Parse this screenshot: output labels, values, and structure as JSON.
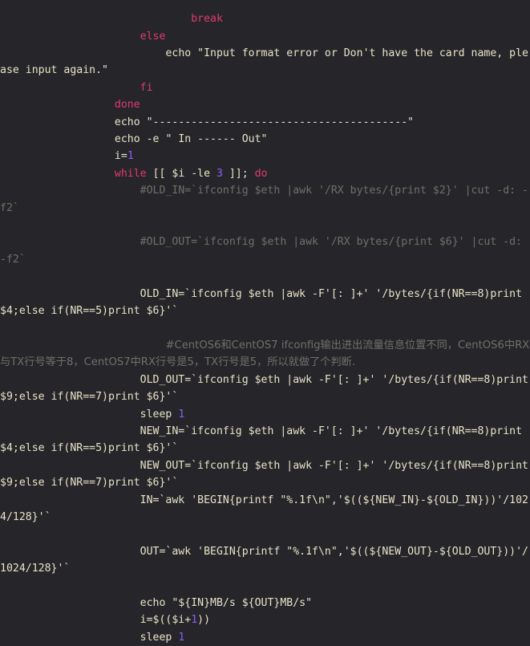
{
  "editor": {
    "background_color": "#26262a",
    "default_text_color": "#e8e2c8",
    "keyword_color": "#e03a6d",
    "number_color": "#8b5cf6",
    "comment_color": "#6f6f68",
    "language": "bash"
  },
  "code": {
    "lines": [
      {
        "indent": 30,
        "segments": [
          {
            "t": "break",
            "c": "kw"
          }
        ]
      },
      {
        "indent": 22,
        "segments": [
          {
            "t": "else",
            "c": "kw"
          }
        ]
      },
      {
        "indent": 26,
        "segments": [
          {
            "t": "echo \"Input format error or Don't have the card name, please input again.\"",
            "c": "plain"
          }
        ]
      },
      {
        "indent": 22,
        "segments": [
          {
            "t": "fi",
            "c": "kw"
          }
        ]
      },
      {
        "indent": 18,
        "segments": [
          {
            "t": "done",
            "c": "kw"
          }
        ]
      },
      {
        "indent": 18,
        "segments": [
          {
            "t": "echo \"----------------------------------------\"",
            "c": "plain"
          }
        ]
      },
      {
        "indent": 18,
        "segments": [
          {
            "t": "echo -e \" In ------ Out\"",
            "c": "plain"
          }
        ]
      },
      {
        "indent": 18,
        "segments": [
          {
            "t": "i=",
            "c": "plain"
          },
          {
            "t": "1",
            "c": "num"
          }
        ]
      },
      {
        "indent": 18,
        "segments": [
          {
            "t": "while",
            "c": "kw"
          },
          {
            "t": " [[ $i -le ",
            "c": "plain"
          },
          {
            "t": "3",
            "c": "num"
          },
          {
            "t": " ]]; ",
            "c": "plain"
          },
          {
            "t": "do",
            "c": "kw"
          }
        ]
      },
      {
        "indent": 22,
        "segments": [
          {
            "t": "#OLD_IN=`ifconfig $eth |awk '/RX bytes/{print $2}' |cut -d: -f2`",
            "c": "cmt"
          }
        ]
      },
      {
        "indent": 22,
        "segments": [
          {
            "t": "",
            "c": "plain"
          }
        ]
      },
      {
        "indent": 22,
        "segments": [
          {
            "t": "#OLD_OUT=`ifconfig $eth |awk '/RX bytes/{print $6}' |cut -d: -f2`",
            "c": "cmt"
          }
        ]
      },
      {
        "indent": 22,
        "segments": [
          {
            "t": "",
            "c": "plain"
          }
        ]
      },
      {
        "indent": 22,
        "segments": [
          {
            "t": "OLD_IN=`ifconfig $eth |awk -F'[: ]+' '/bytes/{if(NR==8)print $4;else if(NR==5)print $6}'`",
            "c": "plain"
          }
        ]
      },
      {
        "indent": 22,
        "segments": [
          {
            "t": "",
            "c": "plain"
          }
        ]
      },
      {
        "indent": 26,
        "segments": [
          {
            "t": "#CentOS6和CentOS7 ifconfig输出进出流量信息位置不同，CentOS6中RX与TX行号等于8，CentOS7中RX行号是5，TX行号是5，所以就做了个判断.",
            "c": "cjk"
          }
        ]
      },
      {
        "indent": 22,
        "segments": [
          {
            "t": "OLD_OUT=`ifconfig $eth |awk -F'[: ]+' '/bytes/{if(NR==8)print $9;else if(NR==7)print $6}'`",
            "c": "plain"
          }
        ]
      },
      {
        "indent": 22,
        "segments": [
          {
            "t": "sleep ",
            "c": "plain"
          },
          {
            "t": "1",
            "c": "num"
          }
        ]
      },
      {
        "indent": 22,
        "segments": [
          {
            "t": "NEW_IN=`ifconfig $eth |awk -F'[: ]+' '/bytes/{if(NR==8)print $4;else if(NR==5)print $6}'`",
            "c": "plain"
          }
        ]
      },
      {
        "indent": 22,
        "segments": [
          {
            "t": "NEW_OUT=`ifconfig $eth |awk -F'[: ]+' '/bytes/{if(NR==8)print $9;else if(NR==7)print $6}'`",
            "c": "plain"
          }
        ]
      },
      {
        "indent": 22,
        "segments": [
          {
            "t": "IN=`awk 'BEGIN{printf \"%.1f\\n\",'$((${NEW_IN}-${OLD_IN}))'/1024/128}'`",
            "c": "plain"
          }
        ]
      },
      {
        "indent": 22,
        "segments": [
          {
            "t": "",
            "c": "plain"
          }
        ]
      },
      {
        "indent": 22,
        "segments": [
          {
            "t": "OUT=`awk 'BEGIN{printf \"%.1f\\n\",'$((${NEW_OUT}-${OLD_OUT}))'/1024/128}'`",
            "c": "plain"
          }
        ]
      },
      {
        "indent": 22,
        "segments": [
          {
            "t": "",
            "c": "plain"
          }
        ]
      },
      {
        "indent": 22,
        "segments": [
          {
            "t": "echo \"${IN}MB/s ${OUT}MB/s\"",
            "c": "plain"
          }
        ]
      },
      {
        "indent": 22,
        "segments": [
          {
            "t": "i=$(($i+",
            "c": "plain"
          },
          {
            "t": "1",
            "c": "num"
          },
          {
            "t": "))",
            "c": "plain"
          }
        ]
      },
      {
        "indent": 22,
        "segments": [
          {
            "t": "sleep ",
            "c": "plain"
          },
          {
            "t": "1",
            "c": "num"
          }
        ]
      }
    ]
  }
}
